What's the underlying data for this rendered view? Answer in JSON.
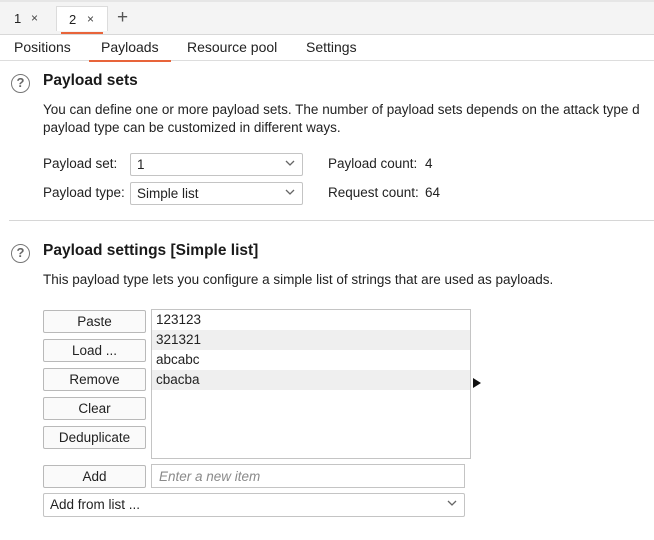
{
  "instance_tabs": [
    {
      "label": "1",
      "close": "×"
    },
    {
      "label": "2",
      "close": "×"
    }
  ],
  "new_tab": "+",
  "sub_tabs": [
    "Positions",
    "Payloads",
    "Resource pool",
    "Settings"
  ],
  "active_sub_tab": "Payloads",
  "accent_color": "#e8643a",
  "payload_sets": {
    "help_icon": "?",
    "title": "Payload sets",
    "description_line1": "You can define one or more payload sets. The number of payload sets depends on the attack type d",
    "description_line2": "payload type can be customized in different ways.",
    "payload_set_label": "Payload set:",
    "payload_set_value": "1",
    "payload_type_label": "Payload type:",
    "payload_type_value": "Simple list",
    "payload_count_label": "Payload count:",
    "payload_count_value": "4",
    "request_count_label": "Request count:",
    "request_count_value": "64"
  },
  "payload_settings": {
    "help_icon": "?",
    "title": "Payload settings [Simple list]",
    "description": "This payload type lets you configure a simple list of strings that are used as payloads.",
    "buttons": {
      "paste": "Paste",
      "load": "Load ...",
      "remove": "Remove",
      "clear": "Clear",
      "deduplicate": "Deduplicate",
      "add": "Add"
    },
    "items": [
      "123123",
      "321321",
      "abcabc",
      "cbacba"
    ],
    "new_item_placeholder": "Enter a new item",
    "add_from_list": "Add from list ..."
  }
}
